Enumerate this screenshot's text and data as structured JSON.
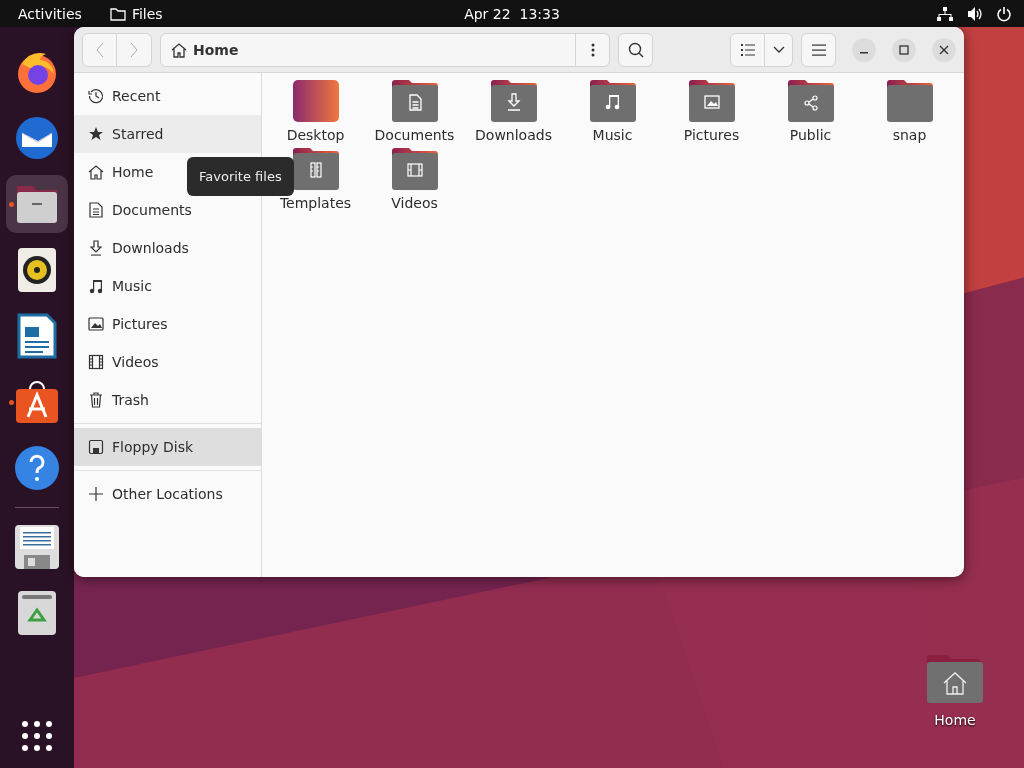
{
  "top_bar": {
    "activities": "Activities",
    "app_menu": "Files",
    "clock": "Apr 22  13:33"
  },
  "dock": {
    "items": [
      {
        "kind": "browser",
        "running": false,
        "selected": false
      },
      {
        "kind": "mail",
        "running": false,
        "selected": false
      },
      {
        "kind": "files",
        "running": true,
        "selected": true
      },
      {
        "kind": "music",
        "running": false,
        "selected": false
      },
      {
        "kind": "writer",
        "running": false,
        "selected": false
      },
      {
        "kind": "store",
        "running": true,
        "selected": false
      },
      {
        "kind": "help",
        "running": false,
        "selected": false
      },
      {
        "kind": "floppy",
        "running": false,
        "selected": false
      },
      {
        "kind": "trash",
        "running": false,
        "selected": false
      }
    ]
  },
  "window": {
    "path": "Home",
    "sidebar": {
      "places": [
        {
          "label": "Recent",
          "kind": "recent",
          "selected": false,
          "hovered": false
        },
        {
          "label": "Starred",
          "kind": "star",
          "selected": false,
          "hovered": true
        },
        {
          "label": "Home",
          "kind": "home",
          "selected": false,
          "hovered": false
        },
        {
          "label": "Documents",
          "kind": "doc",
          "selected": false,
          "hovered": false
        },
        {
          "label": "Downloads",
          "kind": "download",
          "selected": false,
          "hovered": false
        },
        {
          "label": "Music",
          "kind": "music",
          "selected": false,
          "hovered": false
        },
        {
          "label": "Pictures",
          "kind": "picture",
          "selected": false,
          "hovered": false
        },
        {
          "label": "Videos",
          "kind": "video",
          "selected": false,
          "hovered": false
        },
        {
          "label": "Trash",
          "kind": "trash",
          "selected": false,
          "hovered": false
        }
      ],
      "devices": [
        {
          "label": "Floppy Disk",
          "kind": "floppy",
          "selected": true,
          "hovered": false
        }
      ],
      "other": [
        {
          "label": "Other Locations",
          "kind": "plus",
          "selected": false,
          "hovered": false
        }
      ]
    },
    "tooltip": "Favorite files",
    "files": [
      {
        "name": "Desktop",
        "kind": "desktop"
      },
      {
        "name": "Documents",
        "kind": "doc"
      },
      {
        "name": "Downloads",
        "kind": "download"
      },
      {
        "name": "Music",
        "kind": "music"
      },
      {
        "name": "Pictures",
        "kind": "picture"
      },
      {
        "name": "Public",
        "kind": "share"
      },
      {
        "name": "snap",
        "kind": "plain"
      },
      {
        "name": "Templates",
        "kind": "template"
      },
      {
        "name": "Videos",
        "kind": "video"
      }
    ]
  },
  "desktop_icons": [
    {
      "label": "Home",
      "kind": "home"
    }
  ]
}
